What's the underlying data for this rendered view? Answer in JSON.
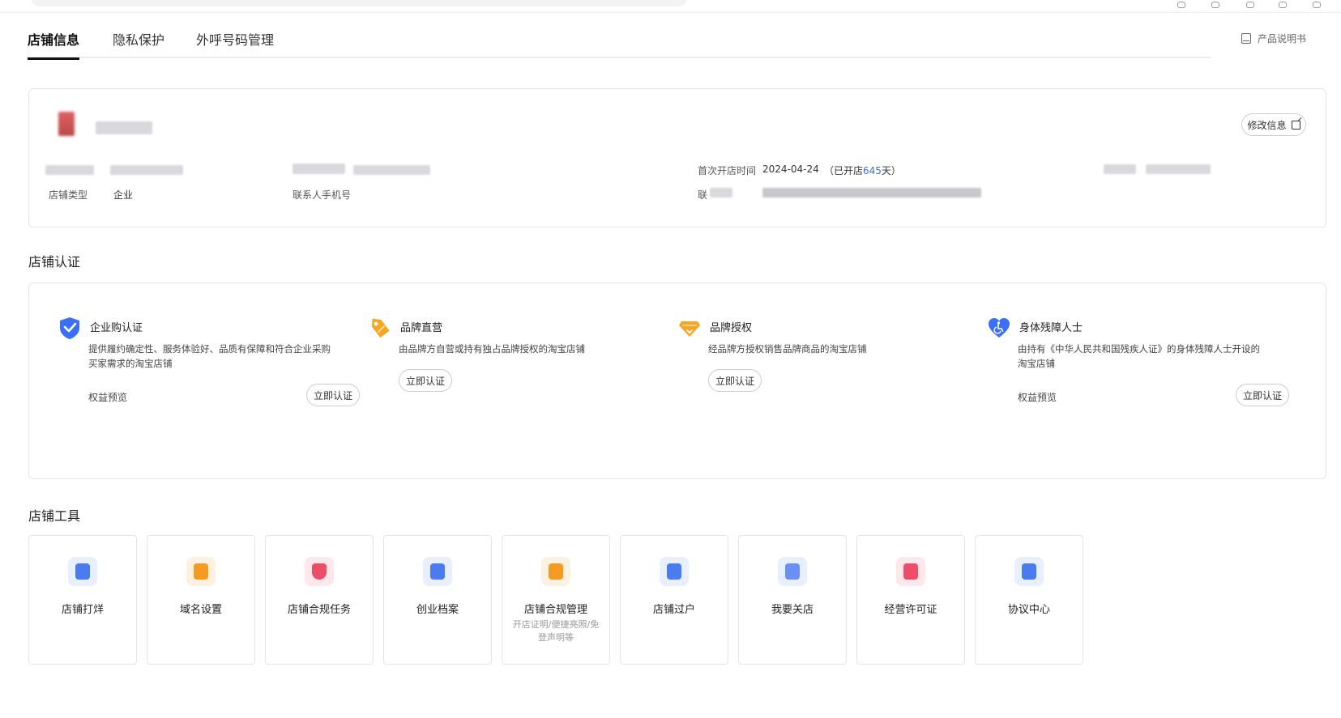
{
  "tabs": [
    {
      "label": "店铺信息"
    },
    {
      "label": "隐私保护"
    },
    {
      "label": "外呼号码管理"
    }
  ],
  "manual_label": "产品说明书",
  "store_info": {
    "edit_button": "修改信息",
    "store_type_label": "店铺类型",
    "store_type_value": "企业",
    "contact_phone_label": "联系人手机号",
    "open_time_label": "首次开店时间",
    "open_time_value": "2024-04-24",
    "open_days_prefix": "（已开店",
    "open_days_value": "645",
    "open_days_suffix": "天）",
    "contact_partial_label": "联"
  },
  "certification": {
    "title": "店铺认证",
    "items": [
      {
        "title": "企业购认证",
        "desc": "提供履约确定性、服务体验好、品质有保障和符合企业采购买家需求的淘宝店铺",
        "link": "权益预览",
        "button": "立即认证",
        "icon": "shield-check-icon",
        "color": "#3b6ff5"
      },
      {
        "title": "品牌直营",
        "desc": "由品牌方自营或持有独占品牌授权的淘宝店铺",
        "link": "",
        "button": "立即认证",
        "icon": "tag-icon",
        "color": "#f5a623"
      },
      {
        "title": "品牌授权",
        "desc": "经品牌方授权销售品牌商品的淘宝店铺",
        "link": "",
        "button": "立即认证",
        "icon": "diamond-icon",
        "color": "#f5a623"
      },
      {
        "title": "身体残障人士",
        "desc": "由持有《中华人民共和国残疾人证》的身体残障人士开设的淘宝店铺",
        "link": "权益预览",
        "button": "立即认证",
        "icon": "heart-accessibility-icon",
        "color": "#3b6ff5"
      }
    ]
  },
  "tools": {
    "title": "店铺工具",
    "items": [
      {
        "label": "店铺打烊",
        "sub": "",
        "icon": "store-close-icon",
        "bg": "#e8efff",
        "fg": "#4a7cf0"
      },
      {
        "label": "域名设置",
        "sub": "",
        "icon": "domain-icon",
        "bg": "#fff1e0",
        "fg": "#f59a23"
      },
      {
        "label": "店铺合规任务",
        "sub": "",
        "icon": "compliance-shield-icon",
        "bg": "#ffe8ec",
        "fg": "#ee4d6a"
      },
      {
        "label": "创业档案",
        "sub": "",
        "icon": "archive-icon",
        "bg": "#e8efff",
        "fg": "#4a7cf0"
      },
      {
        "label": "店铺合规管理",
        "sub": "开店证明/便捷亮照/免登声明等",
        "icon": "doc-manage-icon",
        "bg": "#fff1e0",
        "fg": "#f59a23"
      },
      {
        "label": "店铺过户",
        "sub": "",
        "icon": "transfer-icon",
        "bg": "#e8efff",
        "fg": "#4a7cf0"
      },
      {
        "label": "我要关店",
        "sub": "",
        "icon": "close-store-icon",
        "bg": "#e8efff",
        "fg": "#6a8ff5"
      },
      {
        "label": "经营许可证",
        "sub": "",
        "icon": "license-icon",
        "bg": "#ffe8ec",
        "fg": "#ee4d6a"
      },
      {
        "label": "协议中心",
        "sub": "",
        "icon": "agreement-icon",
        "bg": "#e8efff",
        "fg": "#4a7cf0"
      }
    ]
  }
}
